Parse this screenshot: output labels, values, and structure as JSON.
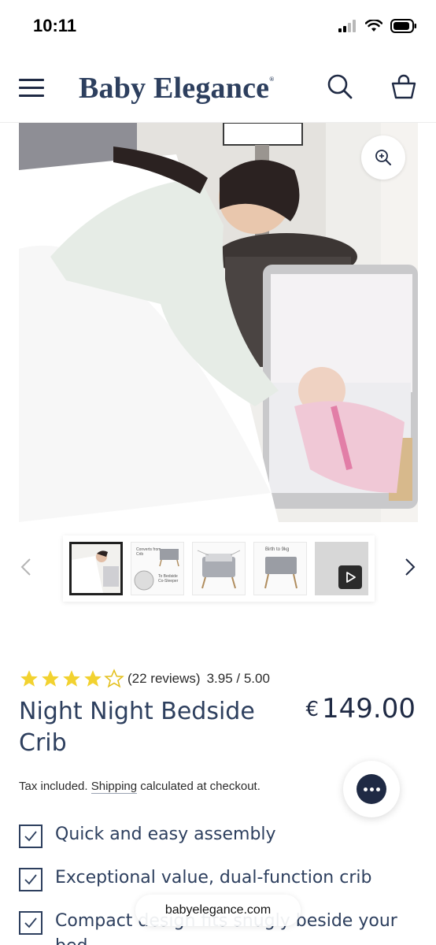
{
  "status_bar": {
    "time": "10:11"
  },
  "header": {
    "brand": "Baby Elegance"
  },
  "gallery": {
    "thumbnails": [
      {
        "label": ""
      },
      {
        "label": "Converts from Crib",
        "sub": "To Bedside Co-Sleeper"
      },
      {
        "label": ""
      },
      {
        "label": "Birth to 9kg"
      },
      {
        "label": ""
      }
    ]
  },
  "product": {
    "rating_value": 3.95,
    "rating_count_text": "(22 reviews)",
    "rating_score_text": "3.95 / 5.00",
    "title": "Night Night Bedside Crib",
    "currency": "€",
    "price": "149.00",
    "tax_prefix": "Tax included.",
    "shipping_link": "Shipping",
    "tax_suffix": "calculated at checkout.",
    "features": [
      "Quick and easy assembly",
      "Exceptional value, dual-function crib",
      "Compact design fits snugly beside your bed"
    ]
  },
  "browser": {
    "url": "babyelegance.com"
  },
  "icons": {
    "menu": "hamburger-icon",
    "search": "search-icon",
    "cart": "shopping-bag-icon",
    "zoom": "zoom-in-icon",
    "chat": "chat-icon",
    "prev": "chevron-left-icon",
    "next": "chevron-right-icon"
  },
  "colors": {
    "brand": "#2d3f5e",
    "star": "#f2d230",
    "text": "#1f2a44"
  }
}
